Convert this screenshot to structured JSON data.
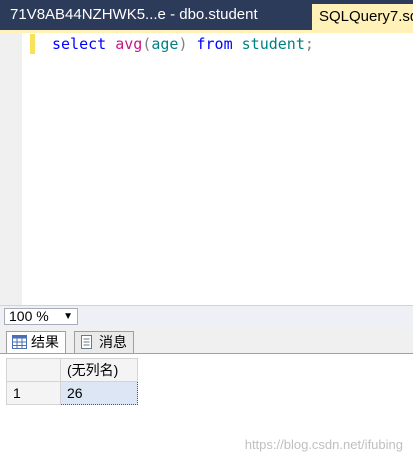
{
  "tabs": [
    {
      "label": "71V8AB44NZHWK5...e - dbo.student",
      "active": false
    },
    {
      "label": "SQLQuery7.sq",
      "active": true
    }
  ],
  "editor": {
    "tokens": [
      {
        "text": "select",
        "kind": "kw"
      },
      {
        "text": " ",
        "kind": "plain"
      },
      {
        "text": "avg",
        "kind": "fn"
      },
      {
        "text": "(",
        "kind": "plain"
      },
      {
        "text": "age",
        "kind": "ident"
      },
      {
        "text": ")",
        "kind": "plain"
      },
      {
        "text": " ",
        "kind": "plain"
      },
      {
        "text": "from",
        "kind": "kw"
      },
      {
        "text": " ",
        "kind": "plain"
      },
      {
        "text": "student",
        "kind": "ident2"
      },
      {
        "text": ";",
        "kind": "plain"
      }
    ]
  },
  "zoom": {
    "value": "100 %"
  },
  "results_tabs": [
    {
      "label": "结果",
      "icon": "grid-icon",
      "active": true
    },
    {
      "label": "消息",
      "icon": "message-icon",
      "active": false
    }
  ],
  "grid": {
    "columns": [
      "(无列名)"
    ],
    "rows": [
      {
        "num": "1",
        "cells": [
          "26"
        ]
      }
    ]
  },
  "watermark": "https://blog.csdn.net/ifubing",
  "colors": {
    "tabstrip": "#2c3b5a",
    "active_tab": "#fff1b8",
    "keyword": "#0000ff",
    "function": "#c71585"
  }
}
